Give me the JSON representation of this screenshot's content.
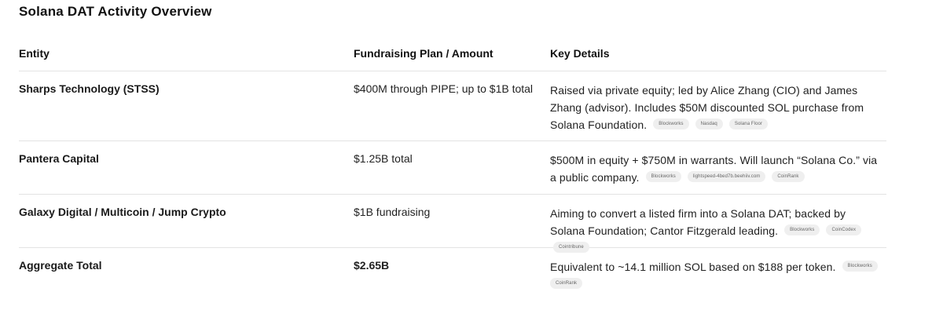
{
  "title": "Solana DAT Activity Overview",
  "headers": {
    "entity": "Entity",
    "fundraising": "Fundraising Plan / Amount",
    "details": "Key Details"
  },
  "rows": [
    {
      "entity": "Sharps Technology (STSS)",
      "amount": "$400M through PIPE; up to $1B total",
      "details": "Raised via private equity; led by Alice Zhang (CIO) and James Zhang (advisor). Includes $50M discounted SOL purchase from Solana Foundation.",
      "sources": [
        "Blockworks",
        "Nasdaq",
        "Solana Floor"
      ]
    },
    {
      "entity": "Pantera Capital",
      "amount": "$1.25B total",
      "details": "$500M in equity + $750M in warrants. Will launch “Solana Co.” via a public company.",
      "sources": [
        "Blockworks",
        "lightspeed-4bed7b.beehiiv.com",
        "CoinRank"
      ]
    },
    {
      "entity": "Galaxy Digital / Multicoin / Jump Crypto",
      "amount": "$1B fundraising",
      "details": "Aiming to convert a listed firm into a Solana DAT; backed by Solana Foundation; Cantor Fitzgerald leading.",
      "sources": [
        "Blockworks",
        "CoinCodex",
        "Cointribune"
      ]
    },
    {
      "entity": "Aggregate Total",
      "amount": "$2.65B",
      "details": "Equivalent to ~14.1 million SOL based on $188 per token.",
      "sources": [
        "Blockworks",
        "CoinRank"
      ]
    }
  ]
}
